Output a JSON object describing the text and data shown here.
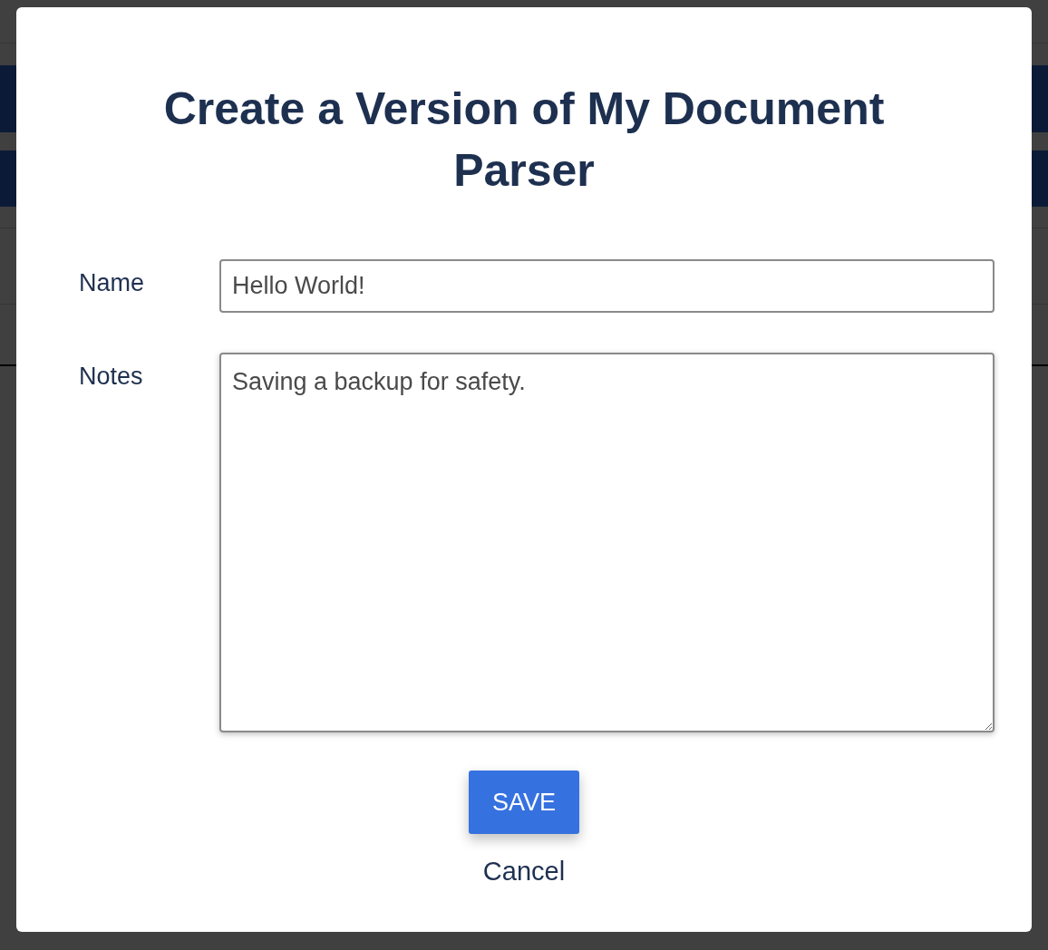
{
  "dialog": {
    "title": "Create a Version of My Document Parser",
    "fields": [
      {
        "kind": "input",
        "label": "Name",
        "value": "Hello World!"
      },
      {
        "kind": "textarea",
        "label": "Notes",
        "value": "Saving a backup for safety."
      }
    ],
    "buttons": [
      {
        "kind": "primary",
        "label": "SAVE"
      },
      {
        "kind": "link",
        "label": "Cancel"
      }
    ]
  }
}
